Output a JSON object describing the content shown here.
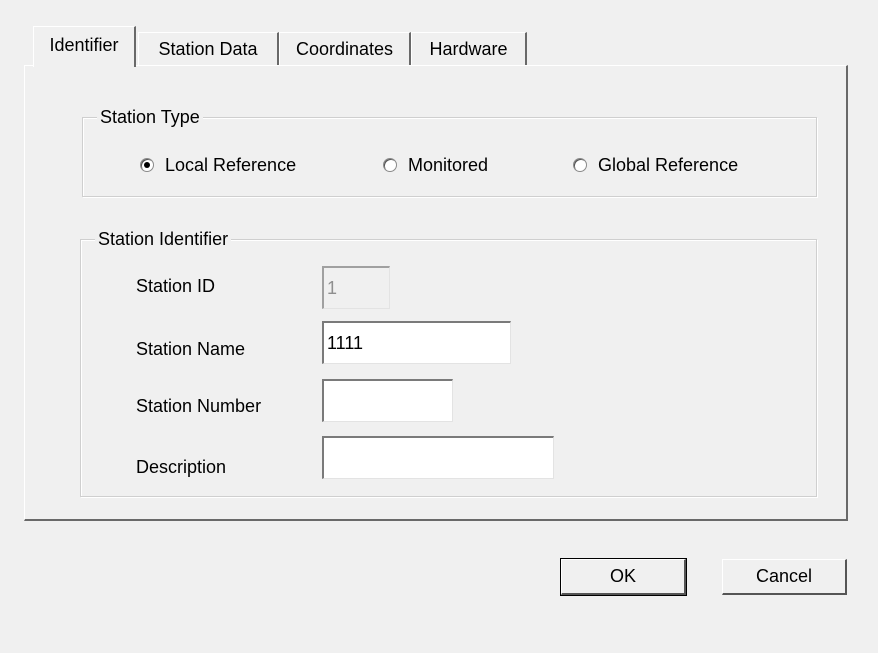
{
  "tabs": [
    {
      "label": "Identifier",
      "active": true
    },
    {
      "label": "Station Data",
      "active": false
    },
    {
      "label": "Coordinates",
      "active": false
    },
    {
      "label": "Hardware",
      "active": false
    }
  ],
  "station_type": {
    "group_label": "Station Type",
    "options": [
      {
        "label": "Local Reference",
        "checked": true
      },
      {
        "label": "Monitored",
        "checked": false
      },
      {
        "label": "Global Reference",
        "checked": false
      }
    ]
  },
  "station_identifier": {
    "group_label": "Station Identifier",
    "station_id": {
      "label": "Station ID",
      "value": "1"
    },
    "station_name": {
      "label": "Station Name",
      "value": "1111"
    },
    "station_number": {
      "label": "Station Number",
      "value": ""
    },
    "description": {
      "label": "Description",
      "value": ""
    }
  },
  "buttons": {
    "ok_label": "OK",
    "cancel_label": "Cancel"
  }
}
